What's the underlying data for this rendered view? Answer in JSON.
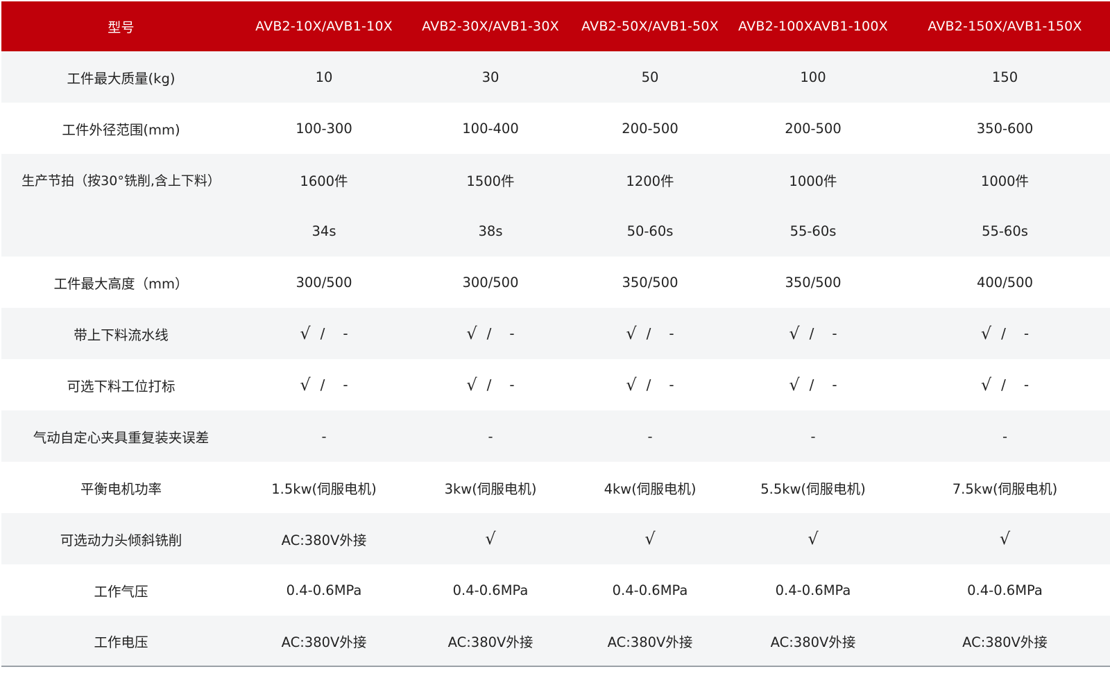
{
  "table": {
    "columns": [
      "型号",
      "AVB2-10X/AVB1-10X",
      "AVB2-30X/AVB1-30X",
      "AVB2-50X/AVB1-50X",
      "AVB2-100XAVB1-100X",
      "AVB2-150X/AVB1-150X"
    ],
    "rows": [
      {
        "label": "工件最大质量(kg)",
        "values": [
          "10",
          "30",
          "50",
          "100",
          "150"
        ]
      },
      {
        "label": "工件外径范围(mm)",
        "values": [
          "100-300",
          "100-400",
          "200-500",
          "200-500",
          "350-600"
        ]
      },
      {
        "label": "生产节拍（按30°铣削,含上下料）",
        "values": [
          "1600件",
          "1500件",
          "1200件",
          "1000件",
          "1000件"
        ],
        "values2": [
          "34s",
          "38s",
          "50-60s",
          "55-60s",
          "55-60s"
        ]
      },
      {
        "label": "工件最大高度（mm）",
        "values": [
          "300/500",
          "300/500",
          "350/500",
          "350/500",
          "400/500"
        ]
      },
      {
        "label": "带上下料流水线",
        "marks": [
          "√",
          "/",
          "-"
        ]
      },
      {
        "label": "可选下料工位打标",
        "marks": [
          "√",
          "/",
          "-"
        ]
      },
      {
        "label": "气动自定心夹具重复装夹误差",
        "values": [
          "-",
          "-",
          "-",
          "-",
          "-"
        ]
      },
      {
        "label": "平衡电机功率",
        "values": [
          "1.5kw(伺服电机)",
          "3kw(伺服电机)",
          "4kw(伺服电机)",
          "5.5kw(伺服电机)",
          "7.5kw(伺服电机)"
        ]
      },
      {
        "label": "可选动力头倾斜铣削",
        "values": [
          "AC:380V外接",
          "√",
          "√",
          "√",
          "√"
        ]
      },
      {
        "label": "工作气压",
        "values": [
          "0.4-0.6MPa",
          "0.4-0.6MPa",
          "0.4-0.6MPa",
          "0.4-0.6MPa",
          "0.4-0.6MPa"
        ]
      },
      {
        "label": "工作电压",
        "values": [
          "AC:380V外接",
          "AC:380V外接",
          "AC:380V外接",
          "AC:380V外接",
          "AC:380V外接"
        ]
      }
    ]
  },
  "colors": {
    "header_bg": "#c0000a",
    "header_text": "#ffffff",
    "shaded_row": "#f4f5f6",
    "body_text": "#222222"
  }
}
